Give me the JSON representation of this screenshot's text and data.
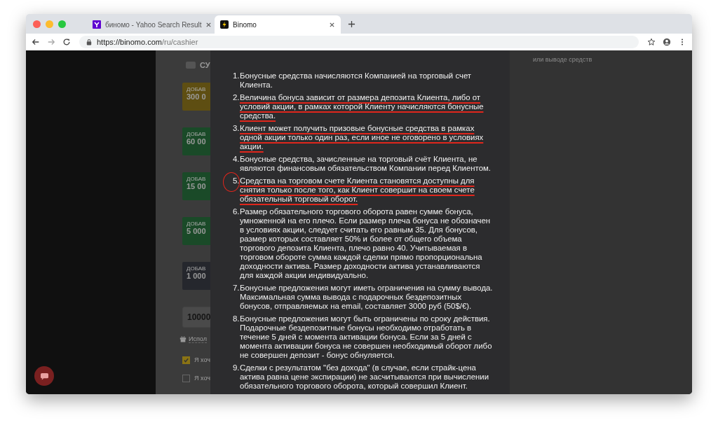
{
  "tabs": [
    {
      "title": "биномо - Yahoo Search Result",
      "selected": false
    },
    {
      "title": "Binomo",
      "selected": true
    }
  ],
  "address_bar": {
    "url_host": "https://binomo.com",
    "url_path": "/ru/cashier"
  },
  "background_page": {
    "heading": "СУ",
    "cards": [
      {
        "label": "ДОБАВ",
        "amount": "300 0",
        "color": "#5e4e12"
      },
      {
        "label": "ДОБАВ",
        "amount": "60 00",
        "color": "#1a4a28"
      },
      {
        "label": "ДОБАВ",
        "amount": "15 00",
        "color": "#1a4a28"
      },
      {
        "label": "ДОБАВ",
        "amount": "5 000",
        "color": "#1a4a28"
      },
      {
        "label": "ДОБАВ",
        "amount": "1 000",
        "color": "#25272d"
      }
    ],
    "amount_field": "10000",
    "promo_link": "Испол",
    "options": [
      {
        "label": "Я хоч",
        "checked": true
      },
      {
        "label": "Я хоч",
        "checked": false
      }
    ],
    "right_note": "или выводе средств"
  },
  "modal": {
    "items": [
      {
        "number": "1.",
        "text": "Бонусные средства начисляются Компанией на торговый счет Клиента.",
        "underlined": false,
        "circled": false
      },
      {
        "number": "2.",
        "text": "Величина бонуса зависит от размера депозита Клиента, либо от условий акции, в рамках которой Клиенту начисляются бонусные средства.",
        "underlined": true,
        "circled": false
      },
      {
        "number": "3.",
        "text": "Клиент может получить призовые бонусные средства в рамках одной акции только один раз, если иное не оговорено в условиях акции.",
        "underlined": true,
        "circled": false
      },
      {
        "number": "4.",
        "text": "Бонусные средства, зачисленные на торговый счёт Клиента, не являются финансовым обязательством Компании перед Клиентом.",
        "underlined": false,
        "circled": false
      },
      {
        "number": "5.",
        "text": "Средства на торговом счете Клиента становятся доступны для снятия только после того, как Клиент совершит на своем счете обязательный торговый оборот.",
        "underlined": true,
        "circled": true
      },
      {
        "number": "6.",
        "text": "Размер обязательного торгового оборота равен сумме бонуса, умноженной на его плечо. Если размер плеча бонуса не обозначен в условиях акции, следует считать его равным 35. Для бонусов, размер которых составляет 50% и более от общего объема торгового депозита Клиента, плечо равно 40. Учитываемая в торговом обороте сумма каждой сделки прямо пропорциональна доходности актива. Размер доходности актива устанавливаются для каждой акции индивидуально.",
        "underlined": false,
        "circled": false
      },
      {
        "number": "7.",
        "text": "Бонусные предложения могут иметь ограничения на сумму вывода. Максимальная сумма вывода с подарочных бездепозитных бонусов, отправляемых на email, составляет 3000 руб (50$/€).",
        "underlined": false,
        "circled": false
      },
      {
        "number": "8.",
        "text": "Бонусные предложения могут быть ограничены по сроку действия. Подарочные бездепозитные бонусы необходимо отработать в течение 5 дней с момента активации бонуса. Если за 5 дней с момента активации бонуса не совершен необходимый оборот либо не совершен депозит - бонус обнуляется.",
        "underlined": false,
        "circled": false
      },
      {
        "number": "9.",
        "text": "Сделки с результатом \"без дохода\" (в случае, если страйк-цена актива равна цене экспирации) не засчитываются при вычислении обязательного торгового оборота, который совершил Клиент.",
        "underlined": false,
        "circled": false
      }
    ]
  }
}
